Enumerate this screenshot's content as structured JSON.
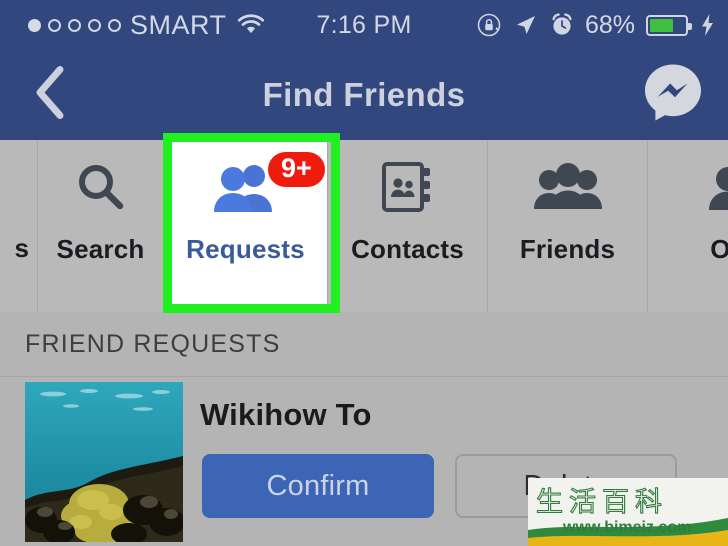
{
  "status_bar": {
    "carrier": "SMART",
    "signal_dots_total": 5,
    "signal_dots_filled": 1,
    "wifi_icon": "wifi-icon",
    "time": "7:16 PM",
    "rotation_lock_icon": "rotation-lock-icon",
    "location_icon": "location-arrow-icon",
    "alarm_icon": "alarm-clock-icon",
    "battery_percent": "68%",
    "battery_level": 68,
    "battery_charging": true,
    "charging_icon": "lightning-bolt-icon",
    "background_color": "#31477e",
    "text_color": "#d3d8e4"
  },
  "nav_bar": {
    "back_icon": "chevron-left-icon",
    "title": "Find Friends",
    "right_icon": "messenger-icon",
    "background_color": "#31477e"
  },
  "tab_bar": {
    "partial_left_label": "s",
    "tabs": [
      {
        "label": "Search",
        "icon": "magnifier-icon",
        "active": false,
        "badge": null
      },
      {
        "label": "Requests",
        "icon": "two-people-icon",
        "active": true,
        "badge": "9+"
      },
      {
        "label": "Contacts",
        "icon": "address-book-icon",
        "active": false,
        "badge": null
      },
      {
        "label": "Friends",
        "icon": "people-group-icon",
        "active": false,
        "badge": null
      },
      {
        "label": "Outg",
        "icon": "person-icon",
        "active": false,
        "badge": null
      }
    ],
    "active_tab_text_color": "#3b5a98",
    "badge_color": "#ef1b0f",
    "background_color": "#b9b9b9"
  },
  "highlight": {
    "color": "#20f020",
    "target": "Requests"
  },
  "section": {
    "header": "FRIEND REQUESTS"
  },
  "request": {
    "name": "Wikihow To",
    "avatar_alt": "coral-reef-underwater-photo",
    "confirm_label": "Confirm",
    "delete_label": "Delete",
    "confirm_color": "#3d65b5"
  },
  "watermark": {
    "chinese_text": "生活百科",
    "url": "www.bimeiz.com"
  }
}
